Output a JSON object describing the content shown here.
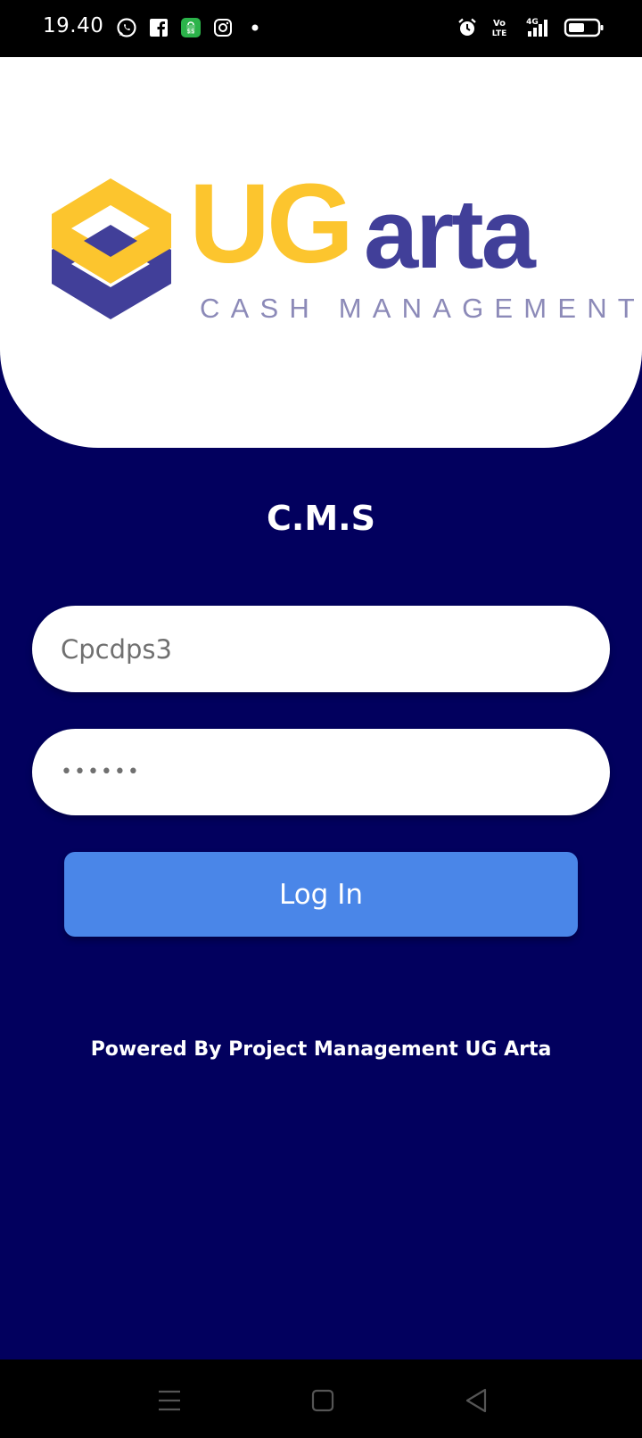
{
  "status_bar": {
    "time": "19.40",
    "left_icons": [
      "whatsapp-icon",
      "facebook-icon",
      "shopping-bag-icon",
      "instagram-icon",
      "dot-icon"
    ],
    "right_icons": [
      "alarm-icon",
      "volte-icon",
      "signal-4g-icon",
      "battery-icon"
    ],
    "network_label": "4G",
    "volte_label": "Vo LTE"
  },
  "logo": {
    "brand_ug": "UG",
    "brand_arta": "arta",
    "tagline": "CASH MANAGEMENT",
    "colors": {
      "yellow": "#fcc52e",
      "indigo": "#413f99",
      "tagline": "#8c8ab8"
    }
  },
  "login": {
    "title": "C.M.S",
    "username_value": "Cpcdps3",
    "password_value": "••••••",
    "login_button_label": "Log In"
  },
  "footer": {
    "powered_by": "Powered By Project Management UG Arta"
  },
  "nav_bar": {
    "buttons": [
      "menu-icon",
      "home-icon",
      "back-icon"
    ]
  },
  "colors": {
    "background": "#02005e",
    "button": "#4a86e8",
    "card": "#ffffff"
  }
}
